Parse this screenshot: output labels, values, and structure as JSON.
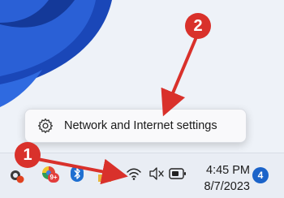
{
  "context_menu": {
    "item_label": "Network and Internet settings",
    "icon": "gear-icon"
  },
  "tray": {
    "icons": [
      "weather-icon",
      "color-app-icon",
      "bluetooth-icon",
      "folder-icon",
      "wifi-icon",
      "speaker-muted-icon",
      "battery-icon"
    ],
    "app_badge": "9+"
  },
  "clock": {
    "time": "4:45 PM",
    "date": "8/7/2023"
  },
  "notifications": {
    "count": "4"
  },
  "annotations": {
    "step1": "1",
    "step2": "2",
    "color": "#d9312b"
  },
  "colors": {
    "wallpaper_blue": "#1a47b8",
    "notification_badge": "#1b63c9"
  }
}
